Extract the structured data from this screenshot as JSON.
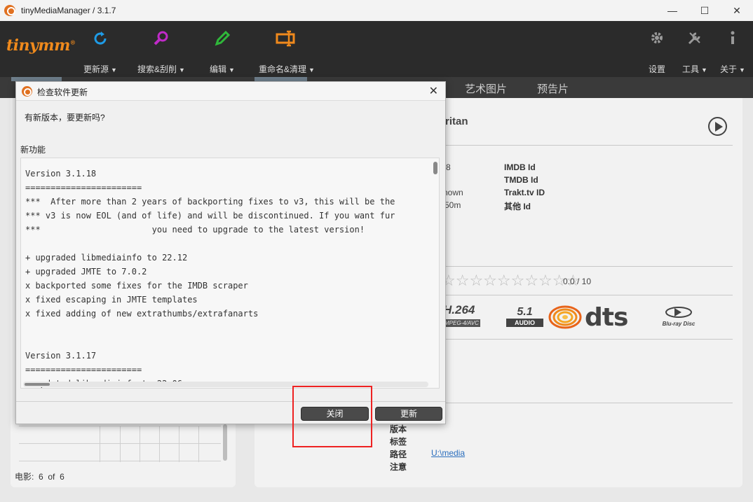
{
  "window": {
    "title": "tinyMediaManager / 3.1.7",
    "minimize": "—",
    "maximize": "☐",
    "close": "✕"
  },
  "toolbar": {
    "logo": "tinymm",
    "logo_mark": "®",
    "update_source": "更新源",
    "search_scrape": "搜索&刮削",
    "edit": "编辑",
    "rename_clean": "重命名&清理",
    "settings": "设置",
    "tools": "工具",
    "about": "关于",
    "caret": "▼"
  },
  "tabs": {
    "artwork": "艺术图片",
    "trailer": "预告片"
  },
  "movie": {
    "title_fragment": "ritan",
    "meta_values": [
      "8",
      "",
      "nown",
      "50m"
    ],
    "meta_keys": [
      "IMDB Id",
      "TMDB Id",
      "Trakt.tv ID",
      "其他 Id"
    ],
    "stars": "☆☆☆☆☆☆☆☆☆☆",
    "rating_value": 0.0,
    "rating": "0.0 / 10",
    "codec": "H.264",
    "codec_sub": "MPEG-4/AVC",
    "audio_channels": "5.1",
    "audio_label": "AUDIO",
    "dts": "dts",
    "bluray": "Blu-ray Disc",
    "detail_keys": [
      "版本",
      "标签",
      "路径",
      "注意"
    ],
    "path": "U:\\media"
  },
  "movie_list": {
    "count_label": "电影:",
    "count_shown": "6",
    "count_of": "of",
    "count_total": "6"
  },
  "dialog": {
    "title": "检查软件更新",
    "close_glyph": "✕",
    "question": "有新版本，要更新吗?",
    "new_features_label": "新功能",
    "changelog": "Version 3.1.18\n=======================\n***  After more than 2 years of backporting fixes to v3, this will be the\n*** v3 is now EOL (and of life) and will be discontinued. If you want fur\n***                      you need to upgrade to the latest version!\n\n+ upgraded libmediainfo to 22.12\n+ upgraded JMTE to 7.0.2\nx backported some fixes for the IMDB scraper\nx fixed escaping in JMTE templates\nx fixed adding of new extrathumbs/extrafanarts\n\n\nVersion 3.1.17\n=======================\n+ updated libmediainfo to 22.06",
    "close_button": "关闭",
    "update_button": "更新"
  }
}
